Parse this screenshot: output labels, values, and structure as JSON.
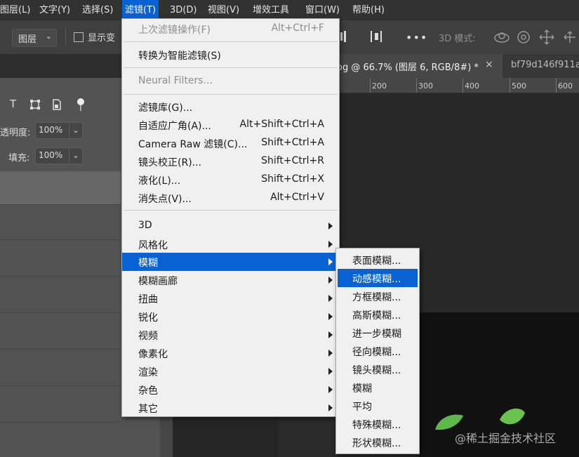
{
  "menubar": {
    "items": [
      "图层(L)",
      "文字(Y)",
      "选择(S)",
      "滤镜(T)",
      "3D(D)",
      "视图(V)",
      "增效工具",
      "窗口(W)",
      "帮助(H)"
    ],
    "active": "滤镜(T)"
  },
  "options": {
    "layer_select": "图层",
    "show_transform_label": "显示变",
    "mode3d_label": "3D 模式:"
  },
  "tabs": {
    "active_label": "og @ 66.7% (图层 6, RGB/8#) *",
    "close_glyph": "×",
    "second_label": "bf79d146f911a"
  },
  "ruler": {
    "labels": [
      "200",
      "300",
      "400",
      "500",
      "600"
    ]
  },
  "layers_panel": {
    "opacity_label": "透明度:",
    "opacity_value": "100%",
    "fill_label": "填充:",
    "fill_value": "100%"
  },
  "filter_menu": {
    "items": [
      {
        "label": "上次滤镜操作(F)",
        "shortcut": "Alt+Ctrl+F",
        "disabled": true
      },
      {
        "label": "转换为智能滤镜(S)",
        "shortcut": ""
      },
      {
        "label": "Neural Filters...",
        "shortcut": "",
        "disabled": true
      },
      {
        "label": "滤镜库(G)...",
        "shortcut": ""
      },
      {
        "label": "自适应广角(A)...",
        "shortcut": "Alt+Shift+Ctrl+A"
      },
      {
        "label": "Camera Raw 滤镜(C)...",
        "shortcut": "Shift+Ctrl+A"
      },
      {
        "label": "镜头校正(R)...",
        "shortcut": "Shift+Ctrl+R"
      },
      {
        "label": "液化(L)...",
        "shortcut": "Shift+Ctrl+X"
      },
      {
        "label": "消失点(V)...",
        "shortcut": "Alt+Ctrl+V"
      },
      {
        "label": "3D",
        "submenu": true
      },
      {
        "label": "风格化",
        "submenu": true
      },
      {
        "label": "模糊",
        "submenu": true,
        "highlighted": true
      },
      {
        "label": "模糊画廊",
        "submenu": true
      },
      {
        "label": "扭曲",
        "submenu": true
      },
      {
        "label": "锐化",
        "submenu": true
      },
      {
        "label": "视频",
        "submenu": true
      },
      {
        "label": "像素化",
        "submenu": true
      },
      {
        "label": "渲染",
        "submenu": true
      },
      {
        "label": "杂色",
        "submenu": true
      },
      {
        "label": "其它",
        "submenu": true
      }
    ]
  },
  "blur_submenu": {
    "items": [
      "表面模糊...",
      "动感模糊...",
      "方框模糊...",
      "高斯模糊...",
      "进一步模糊",
      "径向模糊...",
      "镜头模糊...",
      "模糊",
      "平均",
      "特殊模糊...",
      "形状模糊..."
    ],
    "highlighted": "动感模糊..."
  },
  "watermark": "@稀土掘金技术社区",
  "colors": {
    "accent": "#0a62d2",
    "menu_bg": "#f0f0f0",
    "app_bg": "#535353"
  }
}
